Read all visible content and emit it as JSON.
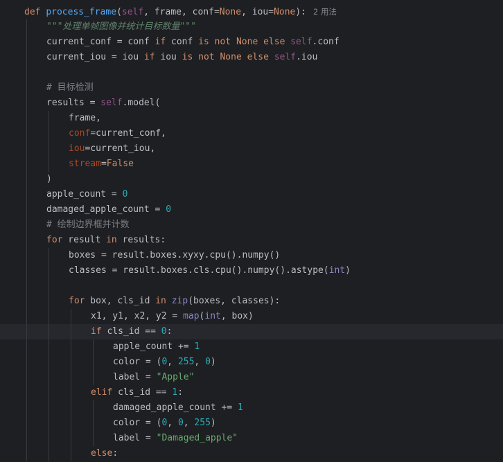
{
  "editor": {
    "usage_hint": "2 用法",
    "lines": [
      {
        "indent": 1,
        "tokens": [
          [
            "kw",
            "def "
          ],
          [
            "fn",
            "process_frame"
          ],
          [
            "",
            "("
          ],
          [
            "slf",
            "self"
          ],
          [
            "",
            ", frame, conf="
          ],
          [
            "kw",
            "None"
          ],
          [
            "",
            ", iou="
          ],
          [
            "kw",
            "None"
          ],
          [
            "",
            "):"
          ]
        ]
      },
      {
        "indent": 2,
        "tokens": [
          [
            "doc",
            "\"\"\"处理单帧图像并统计目标数量\"\"\""
          ]
        ]
      },
      {
        "indent": 2,
        "tokens": [
          [
            "",
            "current_conf = conf "
          ],
          [
            "kw",
            "if"
          ],
          [
            "",
            " conf "
          ],
          [
            "kw",
            "is not None else "
          ],
          [
            "slf",
            "self"
          ],
          [
            "",
            ".conf"
          ]
        ]
      },
      {
        "indent": 2,
        "tokens": [
          [
            "",
            "current_iou = iou "
          ],
          [
            "kw",
            "if"
          ],
          [
            "",
            " iou "
          ],
          [
            "kw",
            "is not None else "
          ],
          [
            "slf",
            "self"
          ],
          [
            "",
            ".iou"
          ]
        ]
      },
      {
        "indent": 2,
        "tokens": []
      },
      {
        "indent": 2,
        "tokens": [
          [
            "cmt",
            "# 目标检测"
          ]
        ]
      },
      {
        "indent": 2,
        "tokens": [
          [
            "",
            "results = "
          ],
          [
            "slf",
            "self"
          ],
          [
            "",
            ".model("
          ]
        ]
      },
      {
        "indent": 3,
        "tokens": [
          [
            "",
            "frame,"
          ]
        ]
      },
      {
        "indent": 3,
        "tokens": [
          [
            "prm",
            "conf"
          ],
          [
            "",
            "=current_conf,"
          ]
        ]
      },
      {
        "indent": 3,
        "tokens": [
          [
            "prm",
            "iou"
          ],
          [
            "",
            "=current_iou,"
          ]
        ]
      },
      {
        "indent": 3,
        "tokens": [
          [
            "prm",
            "stream"
          ],
          [
            "",
            "="
          ],
          [
            "kw",
            "False"
          ]
        ]
      },
      {
        "indent": 2,
        "tokens": [
          [
            "",
            ")"
          ]
        ]
      },
      {
        "indent": 2,
        "tokens": [
          [
            "",
            "apple_count = "
          ],
          [
            "num",
            "0"
          ]
        ]
      },
      {
        "indent": 2,
        "tokens": [
          [
            "",
            "damaged_apple_count = "
          ],
          [
            "num",
            "0"
          ]
        ]
      },
      {
        "indent": 2,
        "tokens": [
          [
            "cmt",
            "# 绘制边界框并计数"
          ]
        ]
      },
      {
        "indent": 2,
        "tokens": [
          [
            "kw",
            "for"
          ],
          [
            "",
            " result "
          ],
          [
            "kw",
            "in"
          ],
          [
            "",
            " results:"
          ]
        ]
      },
      {
        "indent": 3,
        "tokens": [
          [
            "",
            "boxes = result.boxes.xyxy.cpu().numpy()"
          ]
        ]
      },
      {
        "indent": 3,
        "tokens": [
          [
            "",
            "classes = result.boxes.cls.cpu().numpy().astype("
          ],
          [
            "bi",
            "int"
          ],
          [
            "",
            ")"
          ]
        ]
      },
      {
        "indent": 3,
        "tokens": []
      },
      {
        "indent": 3,
        "tokens": [
          [
            "kw",
            "for"
          ],
          [
            "",
            " box, cls_id "
          ],
          [
            "kw",
            "in"
          ],
          [
            "",
            " "
          ],
          [
            "bi",
            "zip"
          ],
          [
            "",
            "(boxes, classes):"
          ]
        ]
      },
      {
        "indent": 4,
        "tokens": [
          [
            "",
            "x1, y1, x2, y2 = "
          ],
          [
            "bi",
            "map"
          ],
          [
            "",
            "("
          ],
          [
            "bi",
            "int"
          ],
          [
            "",
            ", box)"
          ]
        ]
      },
      {
        "indent": 4,
        "current": true,
        "tokens": [
          [
            "kw",
            "if"
          ],
          [
            "",
            " cls_id == "
          ],
          [
            "num",
            "0"
          ],
          [
            "",
            ":"
          ]
        ]
      },
      {
        "indent": 5,
        "tokens": [
          [
            "",
            "apple_count += "
          ],
          [
            "num",
            "1"
          ]
        ]
      },
      {
        "indent": 5,
        "tokens": [
          [
            "",
            "color = ("
          ],
          [
            "num",
            "0"
          ],
          [
            "",
            ", "
          ],
          [
            "num",
            "255"
          ],
          [
            "",
            ", "
          ],
          [
            "num",
            "0"
          ],
          [
            "",
            ")"
          ]
        ]
      },
      {
        "indent": 5,
        "tokens": [
          [
            "",
            "label = "
          ],
          [
            "str",
            "\"Apple\""
          ]
        ]
      },
      {
        "indent": 4,
        "tokens": [
          [
            "kw",
            "elif"
          ],
          [
            "",
            " cls_id == "
          ],
          [
            "num",
            "1"
          ],
          [
            "",
            ":"
          ]
        ]
      },
      {
        "indent": 5,
        "tokens": [
          [
            "",
            "damaged_apple_count += "
          ],
          [
            "num",
            "1"
          ]
        ]
      },
      {
        "indent": 5,
        "tokens": [
          [
            "",
            "color = ("
          ],
          [
            "num",
            "0"
          ],
          [
            "",
            ", "
          ],
          [
            "num",
            "0"
          ],
          [
            "",
            ", "
          ],
          [
            "num",
            "255"
          ],
          [
            "",
            ")"
          ]
        ]
      },
      {
        "indent": 5,
        "tokens": [
          [
            "",
            "label = "
          ],
          [
            "str",
            "\"Damaged_apple\""
          ]
        ]
      },
      {
        "indent": 4,
        "tokens": [
          [
            "kw",
            "else"
          ],
          [
            "",
            ":"
          ]
        ]
      }
    ]
  },
  "colors": {
    "background": "#1e1f22",
    "current_line": "#26282e",
    "keyword": "#cf8e6d",
    "function": "#56a8f5",
    "self": "#94558d",
    "param": "#aa4926",
    "number": "#2aacb8",
    "string": "#6aab73",
    "docstring": "#5f826b",
    "comment": "#7a7e85",
    "builtin": "#8888c6"
  }
}
